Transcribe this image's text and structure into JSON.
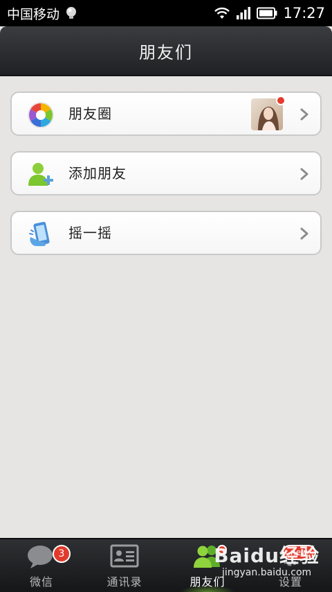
{
  "status_bar": {
    "carrier": "中国移动",
    "time": "17:27"
  },
  "header": {
    "title": "朋友们"
  },
  "menu": {
    "items": [
      {
        "label": "朋友圈",
        "icon": "aperture-icon"
      },
      {
        "label": "添加朋友",
        "icon": "add-friend-icon"
      },
      {
        "label": "摇一摇",
        "icon": "shake-phone-icon"
      }
    ]
  },
  "tabs": [
    {
      "label": "微信",
      "icon": "chat-bubble-icon",
      "badge": "3"
    },
    {
      "label": "通讯录",
      "icon": "contacts-card-icon"
    },
    {
      "label": "朋友们",
      "icon": "friends-icon",
      "active": true
    },
    {
      "label": "设置",
      "icon": "settings-icon",
      "badge": "new"
    }
  ],
  "watermark": {
    "logo": "Baidu经验",
    "url": "jingyan.baidu.com"
  },
  "colors": {
    "accent_green": "#7cc62e",
    "badge_red": "#e03a2d",
    "background": "#e6e5e3"
  }
}
